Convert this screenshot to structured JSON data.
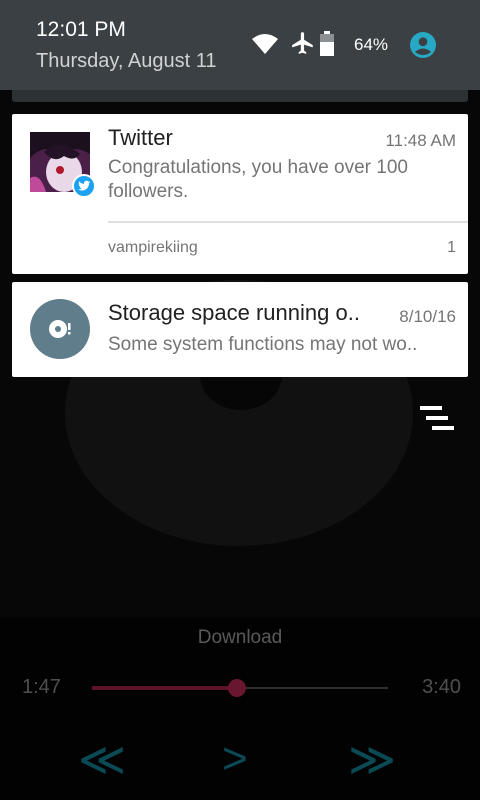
{
  "status_bar": {
    "time": "12:01 PM",
    "date": "Thursday, August 11",
    "battery_percent": "64%",
    "icons": [
      "wifi-icon",
      "airplane-mode-icon",
      "battery-icon",
      "user-account-icon"
    ]
  },
  "notifications": [
    {
      "app": "Twitter",
      "time": "11:48 AM",
      "text": "Congratulations, you have over 100 followers.",
      "account": "vampirekiing",
      "count": "1",
      "icon": "twitter-avatar",
      "badge_icon": "twitter-bird-icon"
    },
    {
      "title": "Storage space running o..",
      "time": "8/10/16",
      "text": "Some system functions may not wo..",
      "icon": "storage-warning-icon"
    }
  ],
  "clear_all_icon": "clear-all-icon",
  "player": {
    "download_label": "Download",
    "elapsed": "1:47",
    "total": "3:40",
    "progress": 0.49,
    "controls": {
      "rewind": "≪",
      "play": ">",
      "fast_forward": "≫"
    }
  },
  "colors": {
    "shade_header": "#3a4043",
    "accent_teal": "#27a9c6",
    "twitter_blue": "#1da1f2",
    "seek_fill": "#5e1428",
    "storage_icon_bg": "#607d8b"
  }
}
